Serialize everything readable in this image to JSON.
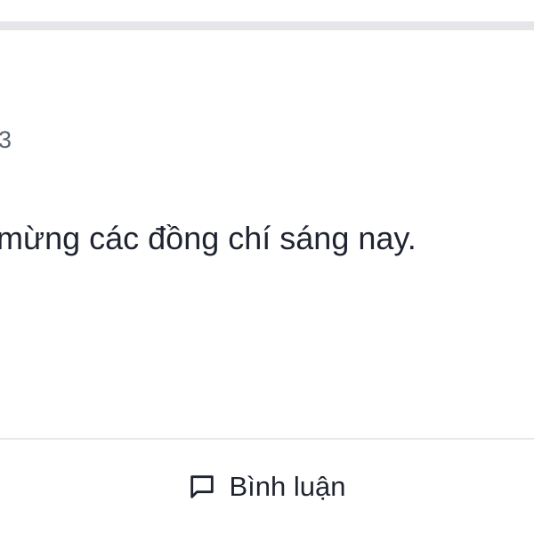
{
  "post": {
    "meta_text": "3",
    "body_text": "mừng các đồng chí sáng nay."
  },
  "actions": {
    "comment_label": "Bình luận",
    "comment_icon": "comment-icon"
  },
  "colors": {
    "divider": "#e6e6ea",
    "text_primary": "#1f2430",
    "text_secondary": "#5b6270"
  }
}
